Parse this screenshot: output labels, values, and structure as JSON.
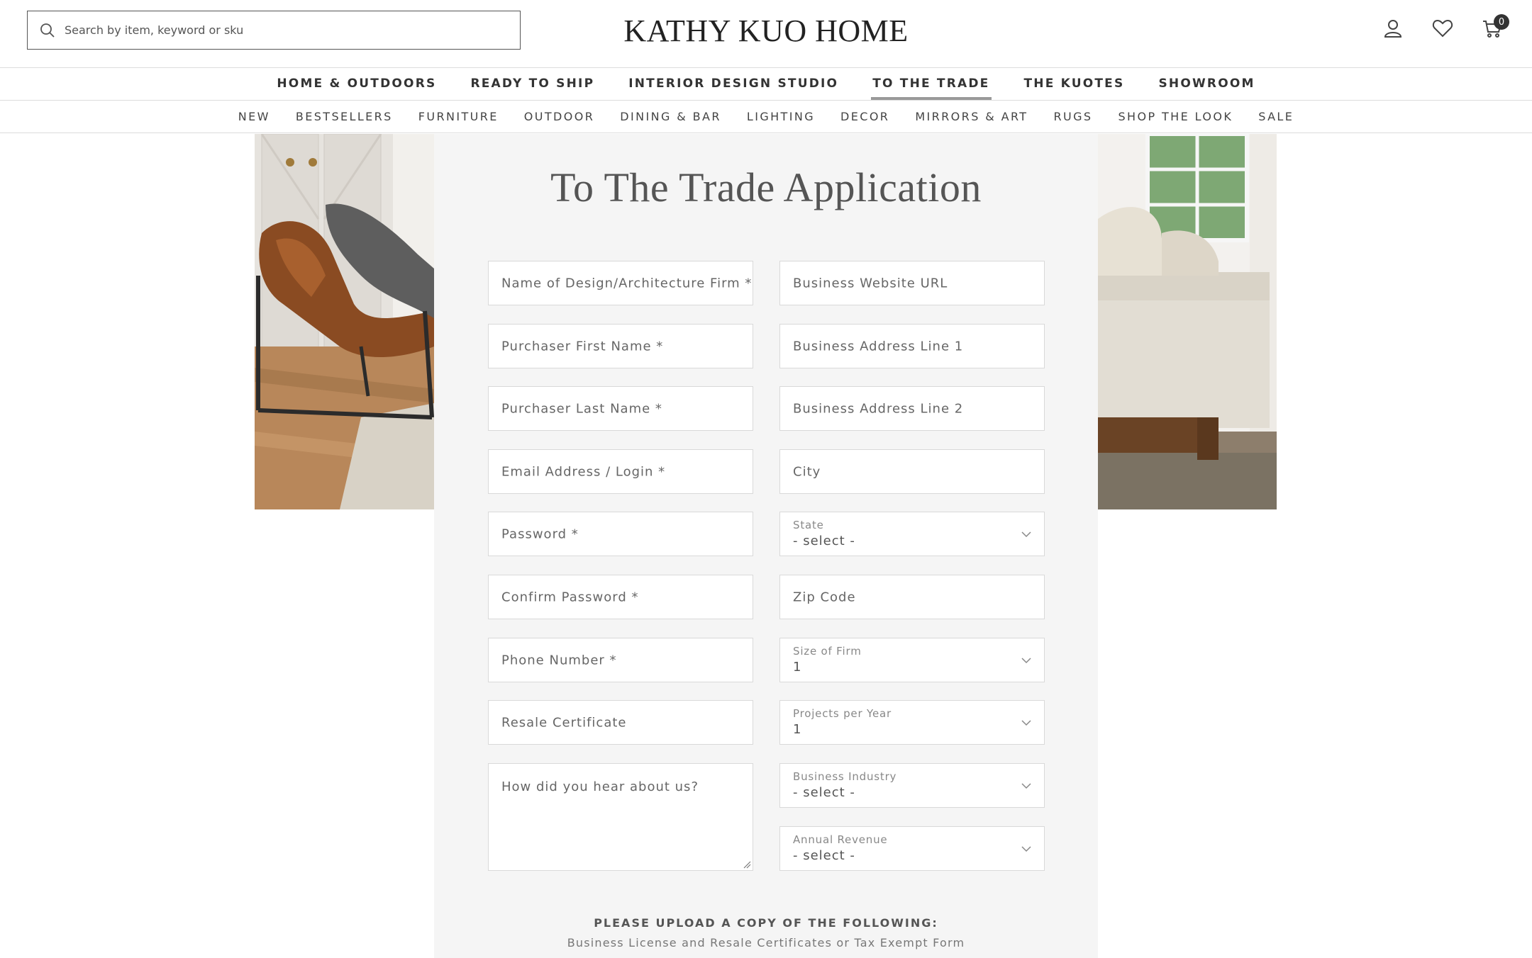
{
  "search": {
    "placeholder": "Search by item, keyword or sku"
  },
  "brand": {
    "logo_text": "KATHY KUO HOME"
  },
  "header_icons": {
    "account": "user-icon",
    "wishlist": "heart-icon",
    "cart": "cart-icon",
    "cart_count": "0"
  },
  "nav_primary": {
    "items": [
      {
        "label": "HOME & OUTDOORS"
      },
      {
        "label": "READY TO SHIP"
      },
      {
        "label": "INTERIOR DESIGN STUDIO"
      },
      {
        "label": "TO THE TRADE"
      },
      {
        "label": "THE KUOTES"
      },
      {
        "label": "SHOWROOM"
      }
    ],
    "active": "TO THE TRADE"
  },
  "nav_secondary": {
    "items": [
      {
        "label": "NEW"
      },
      {
        "label": "BESTSELLERS"
      },
      {
        "label": "FURNITURE"
      },
      {
        "label": "OUTDOOR"
      },
      {
        "label": "DINING & BAR"
      },
      {
        "label": "LIGHTING"
      },
      {
        "label": "DECOR"
      },
      {
        "label": "MIRRORS & ART"
      },
      {
        "label": "RUGS"
      },
      {
        "label": "SHOP THE LOOK"
      },
      {
        "label": "SALE"
      }
    ]
  },
  "form": {
    "title": "To The Trade Application",
    "left_fields": {
      "firm_name": "Name of Design/Architecture Firm *",
      "first_name": "Purchaser First Name *",
      "last_name": "Purchaser Last Name *",
      "email": "Email Address / Login *",
      "password": "Password *",
      "confirm_password": "Confirm Password *",
      "phone": "Phone Number *",
      "resale_certificate": "Resale Certificate",
      "hear_about": "How did you hear about us?"
    },
    "right_fields": {
      "website": "Business Website URL",
      "address1": "Business Address Line 1",
      "address2": "Business Address Line 2",
      "city": "City",
      "state": {
        "label": "State",
        "value": "- select -"
      },
      "zip": "Zip Code",
      "firm_size": {
        "label": "Size of Firm",
        "value": "1"
      },
      "projects": {
        "label": "Projects per Year",
        "value": "1"
      },
      "industry": {
        "label": "Business Industry",
        "value": "- select -"
      },
      "revenue": {
        "label": "Annual Revenue",
        "value": "- select -"
      }
    },
    "upload": {
      "title": "PLEASE UPLOAD A COPY OF THE FOLLOWING:",
      "subtitle": "Business License and Resale Certificates or Tax Exempt Form"
    }
  }
}
